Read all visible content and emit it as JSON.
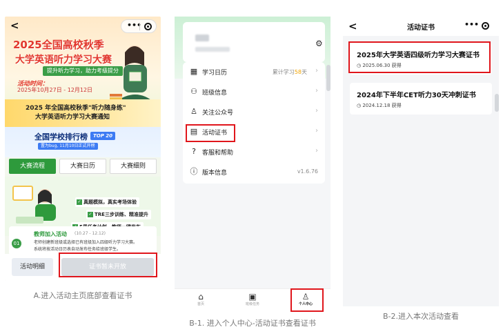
{
  "panel_a": {
    "title_line1": "2025全国高校秋季",
    "title_line2": "大学英语听力学习大赛",
    "subtitle": "提升听力学习，助力考级提分",
    "when_label": "活动时间：",
    "when_value": "2025年10月27日 - 12月12日",
    "notice_line1": "2025 年全国高校秋季\"听力随身练\"",
    "notice_line2": "大学英语听力学习大赛通知",
    "rank_title": "全国学校排行榜",
    "rank_badge": "TOP 20",
    "rank_sub": "置为bug, 11月10日正式开榜",
    "tabs": [
      "大赛流程",
      "大赛日历",
      "大赛细则"
    ],
    "features": [
      "真题模拟，真实考场体验",
      "TRE三步训练、精准提升",
      "5周任务计划、教师一键发布"
    ],
    "step_num": "01",
    "step_title": "教师加入活动",
    "step_date": "(10.27 - 12.12)",
    "step_desc1": "老师创建新班级或选择已有班级加入四级听力学习大赛。",
    "step_desc2": "系统将按活动日历表自动发布任务给班级学生。",
    "btn_detail": "活动明细",
    "btn_cert": "证书暂未开放",
    "caption": "A.进入活动主页底部查看证书"
  },
  "panel_b": {
    "menu": [
      {
        "icon": "calendar-icon",
        "glyph": "▦",
        "label": "学习日历",
        "right_prefix": "累计学习",
        "right_hi": "58",
        "right_suffix": "天"
      },
      {
        "icon": "class-icon",
        "glyph": "⚇",
        "label": "班级信息"
      },
      {
        "icon": "follow-icon",
        "glyph": "♙",
        "label": "关注公众号"
      },
      {
        "icon": "certificate-icon",
        "glyph": "▤",
        "label": "活动证书"
      },
      {
        "icon": "service-icon",
        "glyph": "?",
        "label": "客服和帮助"
      },
      {
        "icon": "info-icon",
        "glyph": "ⓘ",
        "label": "版本信息",
        "right_plain": "v1.6.76"
      }
    ],
    "tabbar": [
      {
        "icon": "home-icon",
        "glyph": "⌂",
        "label": "首页"
      },
      {
        "icon": "task-icon",
        "glyph": "▣",
        "label": "班级任务"
      },
      {
        "icon": "profile-icon",
        "glyph": "♙",
        "label": "个人中心"
      }
    ],
    "caption": "B-1. 进入个人中心-活动证书查看证书"
  },
  "panel_c": {
    "nav_title": "活动证书",
    "certs": [
      {
        "title": "2025年大学英语四级听力学习大赛证书",
        "date": "2025.06.30 获得"
      },
      {
        "title": "2024年下半年CET听力30天冲刺证书",
        "date": "2024.12.18 获得"
      }
    ],
    "caption": "B-2.进入本次活动查看"
  },
  "colors": {
    "highlight": "#e0151b",
    "brand_green": "#2e9a3c",
    "title_red": "#e2382e"
  }
}
